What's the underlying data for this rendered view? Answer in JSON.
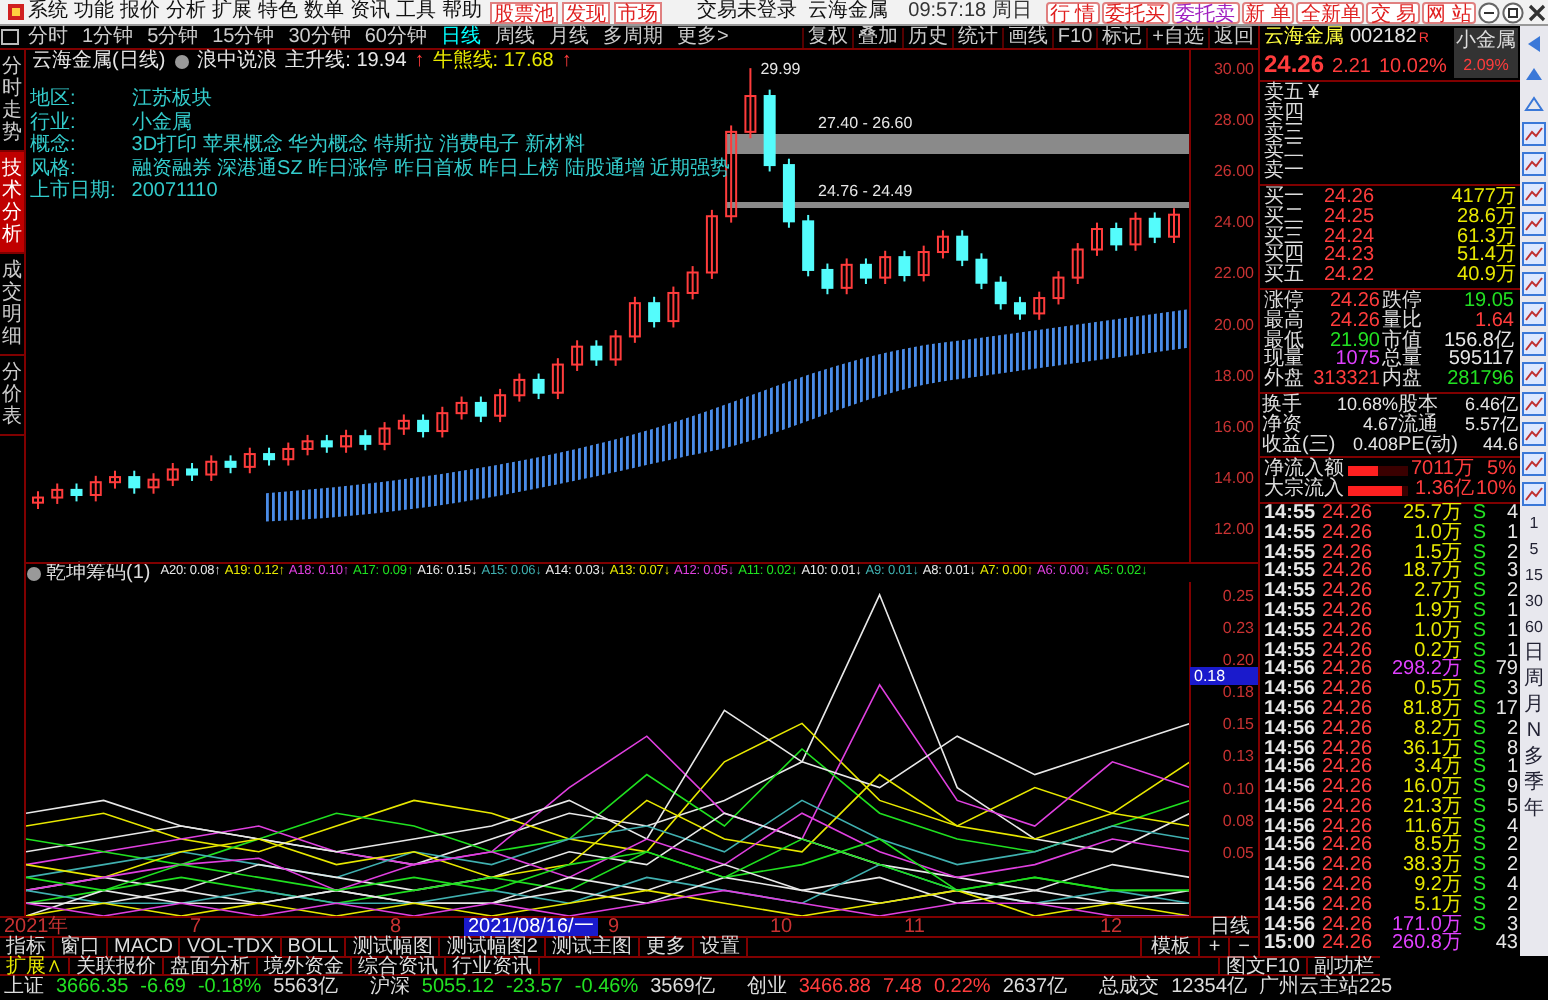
{
  "menu_bar": {
    "items": [
      "系统",
      "功能",
      "报价",
      "分析",
      "扩展",
      "特色",
      "数单",
      "资讯",
      "工具",
      "帮助"
    ],
    "links": [
      "股票池",
      "发现",
      "市场"
    ],
    "title": "交易未登录  云海金属",
    "clock": "09:57:18 周日",
    "buttons": [
      {
        "label": "行 情",
        "color": "#e02020"
      },
      {
        "label": "委托买",
        "color": "#e02020"
      },
      {
        "label": "委托卖",
        "color": "#a020c0"
      },
      {
        "label": "新 单",
        "color": "#e02020"
      },
      {
        "label": "全新单",
        "color": "#e02020"
      },
      {
        "label": "交 易",
        "color": "#e02020"
      },
      {
        "label": "网 站",
        "color": "#e02020"
      }
    ]
  },
  "toolbar": {
    "periods": [
      {
        "label": "分时",
        "selected": false
      },
      {
        "label": "1分钟",
        "selected": false
      },
      {
        "label": "5分钟",
        "selected": false
      },
      {
        "label": "15分钟",
        "selected": false
      },
      {
        "label": "30分钟",
        "selected": false
      },
      {
        "label": "60分钟",
        "selected": false
      },
      {
        "label": "日线",
        "selected": true
      },
      {
        "label": "周线",
        "selected": false
      },
      {
        "label": "月线",
        "selected": false
      },
      {
        "label": "多周期",
        "selected": false
      },
      {
        "label": "更多>",
        "selected": false
      }
    ],
    "tools": [
      "复权",
      "叠加",
      "历史",
      "统计",
      "画线",
      "F10",
      "标记",
      "+自选",
      "返回"
    ]
  },
  "side_tabs": [
    {
      "label": "分时走势",
      "selected": false
    },
    {
      "label": "技术分析",
      "selected": true
    },
    {
      "label": "成交明细",
      "selected": false
    },
    {
      "label": "分价表",
      "selected": false
    }
  ],
  "main_chart": {
    "header": {
      "title": "云海金属(日线)",
      "indicator": "浪中说浪",
      "lines": [
        {
          "label": "主升线: 19.94",
          "arrow": "↑",
          "kind": "main"
        },
        {
          "label": "牛熊线: 17.68",
          "arrow": "↑",
          "kind": "bull"
        }
      ]
    },
    "info": [
      {
        "label": "地区:",
        "value": "江苏板块"
      },
      {
        "label": "行业:",
        "value": "小金属"
      },
      {
        "label": "概念:",
        "value": "3D打印 苹果概念 华为概念 特斯拉 消费电子 新材料"
      },
      {
        "label": "风格:",
        "value": "融资融券 深港通SZ 昨日涨停 昨日首板 昨日上榜 陆股通增 近期强势"
      },
      {
        "label": "上市日期:",
        "value": "20071110"
      }
    ],
    "chart_data": {
      "type": "candlestick",
      "ohlc": [
        [
          13.0,
          13.45,
          12.75,
          13.2
        ],
        [
          13.2,
          13.75,
          12.95,
          13.5
        ],
        [
          13.5,
          13.75,
          13.05,
          13.3
        ],
        [
          13.3,
          14.05,
          13.05,
          13.8
        ],
        [
          13.8,
          14.25,
          13.55,
          14.0
        ],
        [
          14.0,
          14.25,
          13.35,
          13.6
        ],
        [
          13.6,
          14.15,
          13.35,
          13.9
        ],
        [
          13.9,
          14.55,
          13.65,
          14.3
        ],
        [
          14.3,
          14.55,
          13.85,
          14.1
        ],
        [
          14.1,
          14.85,
          13.85,
          14.6
        ],
        [
          14.6,
          14.85,
          14.15,
          14.4
        ],
        [
          14.4,
          15.15,
          14.15,
          14.9
        ],
        [
          14.9,
          15.15,
          14.45,
          14.7
        ],
        [
          14.7,
          15.35,
          14.45,
          15.1
        ],
        [
          15.1,
          15.65,
          14.85,
          15.4
        ],
        [
          15.4,
          15.65,
          14.95,
          15.2
        ],
        [
          15.2,
          15.85,
          14.95,
          15.6
        ],
        [
          15.6,
          15.85,
          15.05,
          15.3
        ],
        [
          15.3,
          16.15,
          15.05,
          15.9
        ],
        [
          15.9,
          16.45,
          15.65,
          16.2
        ],
        [
          16.2,
          16.45,
          15.55,
          15.8
        ],
        [
          15.8,
          16.75,
          15.55,
          16.5
        ],
        [
          16.5,
          17.15,
          16.25,
          16.9
        ],
        [
          16.9,
          17.15,
          16.15,
          16.4
        ],
        [
          16.4,
          17.45,
          16.15,
          17.2
        ],
        [
          17.2,
          18.05,
          16.95,
          17.8
        ],
        [
          17.8,
          18.05,
          17.05,
          17.3
        ],
        [
          17.3,
          18.65,
          17.05,
          18.4
        ],
        [
          18.4,
          19.35,
          18.15,
          19.1
        ],
        [
          19.1,
          19.35,
          18.35,
          18.6
        ],
        [
          18.6,
          19.75,
          18.35,
          19.5
        ],
        [
          19.5,
          21.05,
          19.25,
          20.8
        ],
        [
          20.8,
          21.05,
          19.85,
          20.1
        ],
        [
          20.1,
          21.45,
          19.85,
          21.2
        ],
        [
          21.2,
          22.25,
          20.95,
          22.0
        ],
        [
          22.0,
          24.45,
          21.75,
          24.2
        ],
        [
          24.2,
          27.75,
          23.95,
          27.5
        ],
        [
          27.5,
          29.99,
          27.25,
          28.9
        ],
        [
          28.9,
          29.15,
          25.95,
          26.2
        ],
        [
          26.2,
          26.45,
          23.75,
          24.0
        ],
        [
          24.0,
          24.25,
          21.85,
          22.1
        ],
        [
          22.1,
          22.35,
          21.15,
          21.4
        ],
        [
          21.4,
          22.55,
          21.15,
          22.3
        ],
        [
          22.3,
          22.55,
          21.55,
          21.8
        ],
        [
          21.8,
          22.85,
          21.55,
          22.6
        ],
        [
          22.6,
          22.85,
          21.65,
          21.9
        ],
        [
          21.9,
          23.05,
          21.65,
          22.8
        ],
        [
          22.8,
          23.65,
          22.55,
          23.4
        ],
        [
          23.4,
          23.65,
          22.25,
          22.5
        ],
        [
          22.5,
          22.75,
          21.35,
          21.6
        ],
        [
          21.6,
          21.85,
          20.55,
          20.8
        ],
        [
          20.8,
          21.05,
          20.15,
          20.4
        ],
        [
          20.4,
          21.25,
          20.15,
          21.0
        ],
        [
          21.0,
          22.05,
          20.75,
          21.8
        ],
        [
          21.8,
          23.15,
          21.55,
          22.9
        ],
        [
          22.9,
          23.95,
          22.65,
          23.7
        ],
        [
          23.7,
          23.95,
          22.85,
          23.1
        ],
        [
          23.1,
          24.35,
          22.85,
          24.1
        ],
        [
          24.1,
          24.35,
          23.15,
          23.4
        ],
        [
          23.4,
          24.51,
          23.15,
          24.26
        ]
      ],
      "ylim": [
        10.68,
        30.7
      ],
      "yticks": [
        {
          "value": 30,
          "label": "30.00"
        },
        {
          "value": 28,
          "label": "28.00"
        },
        {
          "value": 26,
          "label": "26.00"
        },
        {
          "value": 24,
          "label": "24.00"
        },
        {
          "value": 22,
          "label": "22.00"
        },
        {
          "value": 20,
          "label": "20.00"
        },
        {
          "value": 18,
          "label": "18.00"
        },
        {
          "value": 16,
          "label": "16.00"
        },
        {
          "value": 14,
          "label": "14.00"
        },
        {
          "value": 12,
          "label": "12.00"
        }
      ],
      "annotations": [
        "29.99"
      ]
    },
    "zones": [
      {
        "label": "27.40 - 26.60",
        "kind": "band"
      },
      {
        "label": "24.76 - 24.49",
        "kind": "line"
      }
    ]
  },
  "indicator_panel": {
    "title": "乾坤筹码(1)",
    "cursor_label": "0.18",
    "chart_data": {
      "type": "line",
      "ylim": [
        0,
        0.26
      ],
      "yticks": [
        {
          "value": 0.25,
          "label": "0.25"
        },
        {
          "value": 0.225,
          "label": "0.23"
        },
        {
          "value": 0.2,
          "label": "0.20"
        },
        {
          "value": 0.175,
          "label": "0.18"
        },
        {
          "value": 0.15,
          "label": "0.15"
        },
        {
          "value": 0.125,
          "label": "0.13"
        },
        {
          "value": 0.1,
          "label": "0.10"
        },
        {
          "value": 0.075,
          "label": "0.08"
        },
        {
          "value": 0.05,
          "label": "0.05"
        }
      ],
      "series": [
        {
          "name": "A20: 0.08↑",
          "color": "#e8e8e8",
          "values": [
            0.05,
            0.06,
            0.07,
            0.06,
            0.05,
            0.04,
            0.06,
            0.08,
            0.07,
            0.09,
            0.12,
            0.25,
            0.1,
            0.06,
            0.05,
            0.08
          ]
        },
        {
          "name": "A19: 0.12↑",
          "color": "#e8e800",
          "values": [
            0.07,
            0.08,
            0.06,
            0.05,
            0.07,
            0.09,
            0.08,
            0.06,
            0.05,
            0.12,
            0.15,
            0.09,
            0.07,
            0.1,
            0.08,
            0.12
          ]
        },
        {
          "name": "A18: 0.10↑",
          "color": "#e040e0",
          "values": [
            0.04,
            0.05,
            0.06,
            0.07,
            0.05,
            0.04,
            0.05,
            0.1,
            0.14,
            0.08,
            0.06,
            0.18,
            0.09,
            0.07,
            0.12,
            0.1
          ]
        },
        {
          "name": "A17: 0.09↑",
          "color": "#20e020",
          "values": [
            0.06,
            0.05,
            0.04,
            0.06,
            0.08,
            0.07,
            0.05,
            0.06,
            0.11,
            0.07,
            0.13,
            0.08,
            0.06,
            0.05,
            0.07,
            0.09
          ]
        },
        {
          "name": "A16: 0.15↓",
          "color": "#e8e8e8",
          "values": [
            0.08,
            0.09,
            0.07,
            0.06,
            0.05,
            0.06,
            0.07,
            0.09,
            0.06,
            0.16,
            0.12,
            0.1,
            0.14,
            0.11,
            0.13,
            0.15
          ]
        },
        {
          "name": "A15: 0.06↓",
          "color": "#40b0b0",
          "values": [
            0.03,
            0.04,
            0.05,
            0.04,
            0.03,
            0.05,
            0.04,
            0.06,
            0.07,
            0.05,
            0.09,
            0.06,
            0.04,
            0.05,
            0.07,
            0.06
          ]
        },
        {
          "name": "A14: 0.03↓",
          "color": "#e8e8e8",
          "values": [
            0.02,
            0.03,
            0.02,
            0.04,
            0.03,
            0.02,
            0.03,
            0.05,
            0.04,
            0.08,
            0.06,
            0.04,
            0.03,
            0.02,
            0.04,
            0.03
          ]
        },
        {
          "name": "A13: 0.07↓",
          "color": "#e8e800",
          "values": [
            0.04,
            0.03,
            0.05,
            0.06,
            0.04,
            0.05,
            0.03,
            0.04,
            0.09,
            0.06,
            0.05,
            0.11,
            0.07,
            0.06,
            0.08,
            0.07
          ]
        },
        {
          "name": "A12: 0.05↓",
          "color": "#e040e0",
          "values": [
            0.02,
            0.03,
            0.04,
            0.045,
            0.02,
            0.04,
            0.05,
            0.03,
            0.06,
            0.04,
            0.08,
            0.05,
            0.03,
            0.04,
            0.06,
            0.05
          ]
        },
        {
          "name": "A11: 0.02↓",
          "color": "#20e020",
          "values": [
            0.01,
            0.02,
            0.03,
            0.02,
            0.01,
            0.02,
            0.03,
            0.02,
            0.05,
            0.03,
            0.04,
            0.06,
            0.02,
            0.03,
            0.02,
            0.02
          ]
        },
        {
          "name": "A10: 0.01↓",
          "color": "#e8e8e8",
          "values": [
            0.01,
            0.01,
            0.02,
            0.01,
            0.02,
            0.01,
            0.01,
            0.03,
            0.02,
            0.04,
            0.02,
            0.03,
            0.01,
            0.02,
            0.01,
            0.01
          ]
        },
        {
          "name": "A9: 0.01↓",
          "color": "#40b0b0",
          "values": [
            0.02,
            0.01,
            0.01,
            0.02,
            0.01,
            0.01,
            0.02,
            0.01,
            0.03,
            0.02,
            0.01,
            0.04,
            0.02,
            0.01,
            0.02,
            0.01
          ]
        },
        {
          "name": "A8: 0.01↓",
          "color": "#e8e8e8",
          "values": [
            0.0,
            0.02,
            0.01,
            0.01,
            0.02,
            0.01,
            0.01,
            0.02,
            0.01,
            0.03,
            0.02,
            0.01,
            0.02,
            0.01,
            0.01,
            0.02
          ]
        },
        {
          "name": "A7: 0.00↑",
          "color": "#e8e800",
          "values": [
            0.0,
            0.01,
            0.0,
            0.01,
            0.0,
            0.01,
            0.0,
            0.01,
            0.02,
            0.01,
            0.0,
            0.01,
            0.02,
            0.0,
            0.01,
            0.0
          ]
        },
        {
          "name": "A6: 0.00↓",
          "color": "#e040e0",
          "values": [
            0.01,
            0.0,
            0.01,
            0.0,
            0.01,
            0.0,
            0.01,
            0.0,
            0.01,
            0.02,
            0.01,
            0.0,
            0.01,
            0.01,
            0.0,
            0.0
          ]
        },
        {
          "name": "A5: 0.02↓",
          "color": "#20e020",
          "values": [
            0.03,
            0.02,
            0.04,
            0.03,
            0.02,
            0.03,
            0.02,
            0.04,
            0.05,
            0.03,
            0.06,
            0.04,
            0.02,
            0.03,
            0.02,
            0.02
          ]
        }
      ]
    }
  },
  "date_axis": [
    {
      "label": "2021年",
      "kind": "year"
    },
    {
      "label": "7",
      "kind": "month"
    },
    {
      "label": "8",
      "kind": "month"
    },
    {
      "label": "2021/08/16/一",
      "kind": "cursor"
    },
    {
      "label": "9",
      "kind": "month"
    },
    {
      "label": "10",
      "kind": "month"
    },
    {
      "label": "11",
      "kind": "month"
    },
    {
      "label": "12",
      "kind": "month"
    }
  ],
  "period_label": "日线",
  "formula_tabs": [
    "指标",
    "窗口",
    "MACD",
    "VOL-TDX",
    "BOLL",
    "测试幅图",
    "测试幅图2",
    "测试主图",
    "更多",
    "设置"
  ],
  "template_buttons": [
    "模板",
    "+",
    "−"
  ],
  "quote_panel": {
    "name": "云海金属",
    "code": "002182",
    "badge": "R",
    "sector": "小金属",
    "sector_change": "2.09%",
    "price": "24.26",
    "change": "2.21",
    "percent": "10.02%",
    "limit_mark": "¥",
    "asks": [
      "卖五",
      "卖四",
      "卖三",
      "卖二",
      "卖一"
    ],
    "bids": [
      {
        "label": "买一",
        "price": "24.26",
        "volume": "4177万"
      },
      {
        "label": "买二",
        "price": "24.25",
        "volume": "28.6万"
      },
      {
        "label": "买三",
        "price": "24.24",
        "volume": "61.3万"
      },
      {
        "label": "买四",
        "price": "24.23",
        "volume": "51.4万"
      },
      {
        "label": "买五",
        "price": "24.22",
        "volume": "40.9万"
      }
    ],
    "stats": [
      {
        "label": "涨停",
        "value": "24.26",
        "color": "#ff3c3c"
      },
      {
        "label": "跌停",
        "value": "19.05",
        "color": "#22e022"
      },
      {
        "label": "最高",
        "value": "24.26",
        "color": "#ff3c3c"
      },
      {
        "label": "量比",
        "value": "1.64",
        "color": "#ff3c3c"
      },
      {
        "label": "最低",
        "value": "21.90",
        "color": "#22e022"
      },
      {
        "label": "市值",
        "value": "156.8亿",
        "color": "#e6e6e6"
      },
      {
        "label": "现量",
        "value": "1075",
        "color": "#e040ff"
      },
      {
        "label": "总量",
        "value": "595117",
        "color": "#e6e6e6"
      },
      {
        "label": "外盘",
        "value": "313321",
        "color": "#ff3c3c"
      },
      {
        "label": "内盘",
        "value": "281796",
        "color": "#22e022"
      }
    ],
    "ratios": [
      {
        "label": "换手",
        "value": "10.68%"
      },
      {
        "label": "股本",
        "value": "6.46亿"
      },
      {
        "label": "净资",
        "value": "4.67"
      },
      {
        "label": "流通",
        "value": "5.57亿"
      },
      {
        "label": "收益(三)",
        "value": "0.408"
      },
      {
        "label": "PE(动)",
        "value": "44.6"
      }
    ],
    "flows": [
      {
        "label": "净流入额",
        "level": 0.5,
        "value": "7011万",
        "percent": "5%"
      },
      {
        "label": "大宗流入",
        "level": 0.9,
        "value": "1.36亿",
        "percent": "10%"
      }
    ],
    "trades": [
      {
        "time": "14:55",
        "price": "24.26",
        "volume": "25.7万",
        "large": false,
        "side": "S",
        "count": "4"
      },
      {
        "time": "14:55",
        "price": "24.26",
        "volume": "1.0万",
        "large": false,
        "side": "S",
        "count": "1"
      },
      {
        "time": "14:55",
        "price": "24.26",
        "volume": "1.5万",
        "large": false,
        "side": "S",
        "count": "2"
      },
      {
        "time": "14:55",
        "price": "24.26",
        "volume": "18.7万",
        "large": false,
        "side": "S",
        "count": "3"
      },
      {
        "time": "14:55",
        "price": "24.26",
        "volume": "2.7万",
        "large": false,
        "side": "S",
        "count": "2"
      },
      {
        "time": "14:55",
        "price": "24.26",
        "volume": "1.9万",
        "large": false,
        "side": "S",
        "count": "1"
      },
      {
        "time": "14:55",
        "price": "24.26",
        "volume": "1.0万",
        "large": false,
        "side": "S",
        "count": "1"
      },
      {
        "time": "14:55",
        "price": "24.26",
        "volume": "0.2万",
        "large": false,
        "side": "S",
        "count": "1"
      },
      {
        "time": "14:56",
        "price": "24.26",
        "volume": "298.2万",
        "large": true,
        "side": "S",
        "count": "79"
      },
      {
        "time": "14:56",
        "price": "24.26",
        "volume": "0.5万",
        "large": false,
        "side": "S",
        "count": "3"
      },
      {
        "time": "14:56",
        "price": "24.26",
        "volume": "81.8万",
        "large": false,
        "side": "S",
        "count": "17"
      },
      {
        "time": "14:56",
        "price": "24.26",
        "volume": "8.2万",
        "large": false,
        "side": "S",
        "count": "2"
      },
      {
        "time": "14:56",
        "price": "24.26",
        "volume": "36.1万",
        "large": false,
        "side": "S",
        "count": "8"
      },
      {
        "time": "14:56",
        "price": "24.26",
        "volume": "3.4万",
        "large": false,
        "side": "S",
        "count": "1"
      },
      {
        "time": "14:56",
        "price": "24.26",
        "volume": "16.0万",
        "large": false,
        "side": "S",
        "count": "9"
      },
      {
        "time": "14:56",
        "price": "24.26",
        "volume": "21.3万",
        "large": false,
        "side": "S",
        "count": "5"
      },
      {
        "time": "14:56",
        "price": "24.26",
        "volume": "11.6万",
        "large": false,
        "side": "S",
        "count": "4"
      },
      {
        "time": "14:56",
        "price": "24.26",
        "volume": "8.5万",
        "large": false,
        "side": "S",
        "count": "2"
      },
      {
        "time": "14:56",
        "price": "24.26",
        "volume": "38.3万",
        "large": false,
        "side": "S",
        "count": "2"
      },
      {
        "time": "14:56",
        "price": "24.26",
        "volume": "9.2万",
        "large": false,
        "side": "S",
        "count": "4"
      },
      {
        "time": "14:56",
        "price": "24.26",
        "volume": "5.1万",
        "large": false,
        "side": "S",
        "count": "2"
      },
      {
        "time": "14:56",
        "price": "24.26",
        "volume": "171.0万",
        "large": true,
        "side": "S",
        "count": "3"
      },
      {
        "time": "15:00",
        "price": "24.26",
        "volume": "260.8万",
        "large": true,
        "count": "43"
      }
    ]
  },
  "side_icons": {
    "periods": [
      "1",
      "5",
      "15",
      "30",
      "60",
      "日",
      "周",
      "月",
      "N",
      "多",
      "季",
      "年"
    ]
  },
  "bottom_tabs": {
    "items": [
      "扩展∧",
      "关联报价",
      "盘面分析",
      "境外资金",
      "综合资讯",
      "行业资讯"
    ],
    "right": [
      "图文F10",
      "副功栏"
    ]
  },
  "status_bar": {
    "indices": [
      {
        "name": "上证",
        "value": "3666.35",
        "change": "-6.69",
        "percent": "-0.18%",
        "amount": "5563亿",
        "color": "#22e022"
      },
      {
        "name": "沪深",
        "value": "5055.12",
        "change": "-23.57",
        "percent": "-0.46%",
        "amount": "3569亿",
        "color": "#22e022"
      },
      {
        "name": "创业",
        "value": "3466.88",
        "change": "7.48",
        "percent": "0.22%",
        "amount": "2637亿",
        "color": "#ff3c3c"
      }
    ],
    "total_label": "总成交",
    "total": "12354亿",
    "server": "广州云主站225"
  }
}
